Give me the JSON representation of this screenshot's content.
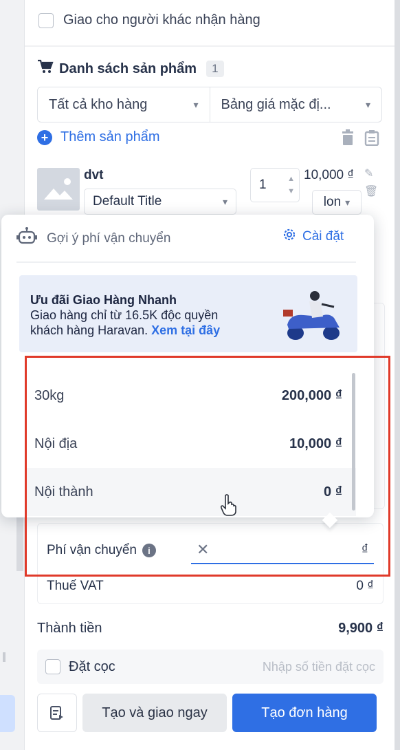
{
  "recipient": {
    "other_receiver_label": "Giao cho người khác nhận hàng"
  },
  "products": {
    "title": "Danh sách sản phẩm",
    "count": "1",
    "warehouse_select": "Tất cả kho hàng",
    "pricelist_select": "Bảng giá mặc đị...",
    "add_product_label": "Thêm sản phẩm",
    "items": [
      {
        "name": "dvt",
        "variant": "Default Title",
        "quantity": "1",
        "price": "10,000 ₫",
        "unit": "lon"
      }
    ]
  },
  "shipping_popover": {
    "title": "Gợi ý phí vận chuyển",
    "settings_label": "Cài đặt",
    "promo": {
      "line1": "Ưu đãi Giao Hàng Nhanh",
      "line2": "Giao hàng chỉ từ 16.5K độc quyền",
      "line3_text": "khách hàng Haravan.",
      "line3_link": "Xem tại đây"
    },
    "options": [
      {
        "name": "30kg",
        "price": "200,000 ₫"
      },
      {
        "name": "Nội địa",
        "price": "10,000 ₫"
      },
      {
        "name": "Nội thành",
        "price": "0 ₫"
      }
    ]
  },
  "summary": {
    "shipping_fee_label": "Phí vận chuyển",
    "shipping_fee_currency": "₫",
    "vat_label": "Thuế VAT",
    "vat_value": "0 ₫",
    "total_label": "Thành tiền",
    "total_value": "9,900 ₫",
    "deposit_label": "Đặt cọc",
    "deposit_placeholder": "Nhập số tiền đặt cọc"
  },
  "actions": {
    "create_and_ship_label": "Tạo và giao ngay",
    "create_order_label": "Tạo đơn hàng"
  },
  "colors": {
    "accent": "#2f6fe4",
    "highlight_border": "#e03a2a"
  }
}
